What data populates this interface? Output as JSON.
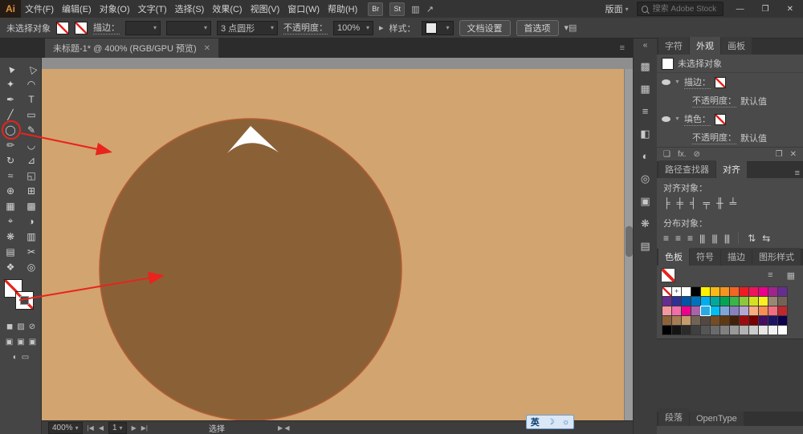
{
  "menu_bar": {
    "logo": "Ai",
    "items": [
      "文件(F)",
      "编辑(E)",
      "对象(O)",
      "文字(T)",
      "选择(S)",
      "效果(C)",
      "视图(V)",
      "窗口(W)",
      "帮助(H)"
    ],
    "bridge": "Br",
    "stock": "St",
    "layout": "版面",
    "search_placeholder": "搜索 Adobe Stock",
    "window_controls": {
      "minimize": "—",
      "restore": "❐",
      "close": "✕"
    }
  },
  "control_bar": {
    "selection_status": "未选择对象",
    "stroke_label": "描边：",
    "brush_name": "3 点圆形",
    "opacity_label": "不透明度：",
    "opacity_value": "100%",
    "style_label": "样式：",
    "document_setup": "文档设置",
    "preferences": "首选项"
  },
  "document_tab": {
    "title": "未标题-1* @ 400% (RGB/GPU 预览)",
    "close": "✕"
  },
  "toolbar": {
    "tools": [
      {
        "name": "selection-tool",
        "glyph": "▲"
      },
      {
        "name": "direct-selection-tool",
        "glyph": "△"
      },
      {
        "name": "magic-wand-tool",
        "glyph": "✦"
      },
      {
        "name": "lasso-tool",
        "glyph": "◠"
      },
      {
        "name": "pen-tool",
        "glyph": "✒"
      },
      {
        "name": "type-tool",
        "glyph": "T"
      },
      {
        "name": "line-segment-tool",
        "glyph": "╱"
      },
      {
        "name": "rectangle-tool",
        "glyph": "▭"
      },
      {
        "name": "ellipse-tool",
        "glyph": "◯",
        "highlight": true
      },
      {
        "name": "paintbrush-tool",
        "glyph": "✎"
      },
      {
        "name": "pencil-tool",
        "glyph": "✏"
      },
      {
        "name": "smooth-tool",
        "glyph": "◡"
      },
      {
        "name": "rotate-tool",
        "glyph": "↻"
      },
      {
        "name": "scale-tool",
        "glyph": "⊿"
      },
      {
        "name": "width-tool",
        "glyph": "≈"
      },
      {
        "name": "free-transform-tool",
        "glyph": "◱"
      },
      {
        "name": "shape-builder-tool",
        "glyph": "⊕"
      },
      {
        "name": "perspective-grid-tool",
        "glyph": "⊞"
      },
      {
        "name": "mesh-tool",
        "glyph": "▦"
      },
      {
        "name": "gradient-tool",
        "glyph": "▩"
      },
      {
        "name": "eyedropper-tool",
        "glyph": "⌖"
      },
      {
        "name": "blend-tool",
        "glyph": "◑"
      },
      {
        "name": "symbol-sprayer-tool",
        "glyph": "❋"
      },
      {
        "name": "column-graph-tool",
        "glyph": "▥"
      },
      {
        "name": "artboard-tool",
        "glyph": "▤"
      },
      {
        "name": "slice-tool",
        "glyph": "✂"
      },
      {
        "name": "hand-tool",
        "glyph": "❖"
      },
      {
        "name": "zoom-tool",
        "glyph": "◎"
      }
    ],
    "mode_rows": [
      {
        "name": "color-mode-row",
        "icons": [
          "◼",
          "▨",
          "⊘"
        ]
      },
      {
        "name": "draw-mode-row",
        "icons": [
          "▣",
          "▣",
          "▣"
        ]
      },
      {
        "name": "screen-mode-row",
        "icons": [
          "◐",
          "▭"
        ]
      }
    ]
  },
  "canvas": {
    "artboard_color": "#d2a46f",
    "circle_fill": "#8a6137",
    "circle_stroke": "#b35b33",
    "triangle_color": "#ffffff",
    "annotation_color": "#e8241d"
  },
  "status_bar": {
    "zoom": "400%",
    "nav_page": "1",
    "tool_label": "选择",
    "ime": {
      "lang": "英",
      "icon1": "☽",
      "icon2": "☼"
    }
  },
  "dock": {
    "expand": "«",
    "icons": [
      {
        "name": "color-panel-icon",
        "glyph": "▩"
      },
      {
        "name": "color-guide-panel-icon",
        "glyph": "▦"
      },
      {
        "name": "stroke-panel-icon",
        "glyph": "≡"
      },
      {
        "name": "gradient-panel-icon",
        "glyph": "◧"
      },
      {
        "name": "transparency-panel-icon",
        "glyph": "◐"
      },
      {
        "name": "appearance-panel-icon",
        "glyph": "◎"
      },
      {
        "name": "graphic-styles-panel-icon",
        "glyph": "▣"
      },
      {
        "name": "symbols-panel-icon",
        "glyph": "❋"
      },
      {
        "name": "layers-panel-icon",
        "glyph": "▤"
      }
    ]
  },
  "panels": {
    "appearance_panel": {
      "tabs": [
        "字符",
        "外观",
        "画板"
      ],
      "active_tab": "外观",
      "no_selection": "未选择对象",
      "stroke_row": {
        "label": "描边："
      },
      "stroke_opacity": {
        "label": "不透明度：",
        "value": "默认值"
      },
      "fill_row": {
        "label": "填色："
      },
      "fill_opacity": {
        "label": "不透明度：",
        "value": "默认值"
      },
      "footer_icons": [
        {
          "name": "add-new-stroke-icon",
          "glyph": "❏"
        },
        {
          "name": "add-new-effect-icon",
          "glyph": "fx."
        },
        {
          "name": "clear-appearance-icon",
          "glyph": "⊘"
        },
        {
          "name": "duplicate-selected-item-icon",
          "glyph": "❐"
        },
        {
          "name": "delete-selected-item-icon",
          "glyph": "✕"
        }
      ]
    },
    "align_panel": {
      "tabs": [
        "路径查找器",
        "对齐"
      ],
      "active_tab": "对齐",
      "align_objects_label": "对齐对象：",
      "align_icons": [
        {
          "name": "align-left-icon",
          "glyph": "╞"
        },
        {
          "name": "align-h-center-icon",
          "glyph": "╪"
        },
        {
          "name": "align-right-icon",
          "glyph": "╡"
        },
        {
          "name": "align-top-icon",
          "glyph": "╤"
        },
        {
          "name": "align-v-center-icon",
          "glyph": "╫"
        },
        {
          "name": "align-bottom-icon",
          "glyph": "╧"
        }
      ],
      "distribute_objects_label": "分布对象：",
      "distribute_icons": [
        {
          "name": "distribute-top-icon",
          "glyph": "≡"
        },
        {
          "name": "distribute-v-center-icon",
          "glyph": "≡"
        },
        {
          "name": "distribute-bottom-icon",
          "glyph": "≡"
        },
        {
          "name": "distribute-left-icon",
          "glyph": "|||"
        },
        {
          "name": "distribute-h-center-icon",
          "glyph": "|||"
        },
        {
          "name": "distribute-right-icon",
          "glyph": "|||"
        }
      ],
      "distribute_extra": [
        {
          "name": "vertical-distribute-space-icon",
          "glyph": "⇅"
        },
        {
          "name": "horizontal-distribute-space-icon",
          "glyph": "⇆"
        }
      ]
    },
    "swatches_panel": {
      "tabs": [
        "色板",
        "符号",
        "描边",
        "图形样式"
      ],
      "active_tab": "色板",
      "grid": [
        [
          "none",
          "reg",
          "#ffffff",
          "#000000",
          "#fff200",
          "#fdb913",
          "#f7941d",
          "#f26522",
          "#ed1c24",
          "#ed145b",
          "#ec008c",
          "#a3238e",
          "#662d91"
        ],
        [
          "#652d90",
          "#2e3192",
          "#0054a6",
          "#0072bc",
          "#00aeef",
          "#00a99d",
          "#00a651",
          "#39b54a",
          "#8dc63f",
          "#d7df23",
          "#fcee21",
          "#998675",
          "#736357"
        ],
        [
          "#f5989d",
          "#f06eaa",
          "#ec008c",
          "#a864a8",
          "#29abe2!",
          "#00bff3",
          "#7da7d9",
          "#8781bd",
          "#b5a5d5",
          "#f9ad81",
          "#f68e56",
          "#f26d7d",
          "#c1272d"
        ],
        [
          "#8c6239",
          "#a67c52",
          "#c69c6d",
          "#736357",
          "#534741",
          "#754c24",
          "#603913",
          "#42210b",
          "#9e0b0f",
          "#790000",
          "#440e62",
          "#1b1464",
          "#0d004c"
        ],
        [
          "#000000",
          "#141414",
          "#2b2b2b",
          "#404040",
          "#555555",
          "#6b6b6b",
          "#808080",
          "#999999",
          "#b3b3b3",
          "#cccccc",
          "#e6e6e6",
          "#f2f2f2",
          "#ffffff"
        ]
      ]
    },
    "bottom_tabs": [
      "段落",
      "OpenType"
    ]
  }
}
